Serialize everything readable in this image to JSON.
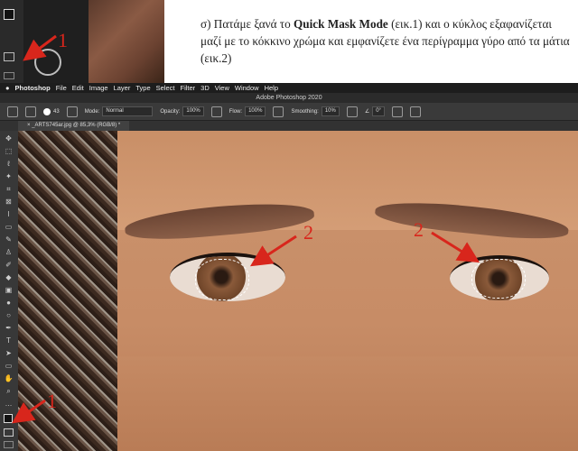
{
  "instruction": {
    "prefix": "σ) Πατάμε ξανά το ",
    "bold": "Quick Mask Mode",
    "suffix": " (εικ.1) και ο κύκλος εξαφανίζεται μαζί με το κόκκινο χρώμα και εμφανίζετε ένα περίγραμμα γύρο από τα μάτια (εικ.2)"
  },
  "annotations": {
    "label_1": "1",
    "label_2": "2",
    "arrow_color": "#d8261c"
  },
  "menubar": {
    "apple": "",
    "app": "Photoshop",
    "items": [
      "File",
      "Edit",
      "Image",
      "Layer",
      "Type",
      "Select",
      "Filter",
      "3D",
      "View",
      "Window",
      "Help"
    ]
  },
  "window_title": "Adobe Photoshop 2020",
  "options_bar": {
    "brush_size": "43",
    "mode_label": "Mode:",
    "mode_value": "Normal",
    "opacity_label": "Opacity:",
    "opacity_value": "100%",
    "flow_label": "Flow:",
    "flow_value": "100%",
    "smoothing_label": "Smoothing:",
    "smoothing_value": "10%",
    "angle_value": "0°"
  },
  "document_tab": {
    "title": "_ARTS745ar.jpg @ 85,3% (RGB/8) *"
  }
}
